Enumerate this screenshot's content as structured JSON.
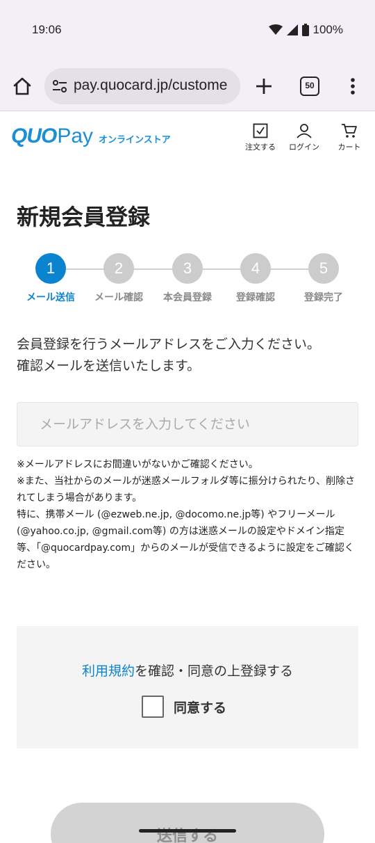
{
  "status_bar": {
    "time": "19:06",
    "battery": "100%"
  },
  "browser": {
    "url": "pay.quocard.jp/custome",
    "tab_count": "50"
  },
  "header": {
    "logo_main": "QUO",
    "logo_pay": "Pay",
    "logo_sub": "オンラインストア",
    "order_label": "注文する",
    "login_label": "ログイン",
    "cart_label": "カート"
  },
  "page": {
    "title": "新規会員登録"
  },
  "stepper": {
    "steps": [
      {
        "number": "1",
        "label": "メール送信",
        "active": true
      },
      {
        "number": "2",
        "label": "メール確認",
        "active": false
      },
      {
        "number": "3",
        "label": "本会員登録",
        "active": false
      },
      {
        "number": "4",
        "label": "登録確認",
        "active": false
      },
      {
        "number": "5",
        "label": "登録完了",
        "active": false
      }
    ]
  },
  "intro": {
    "line1": "会員登録を行うメールアドレスをご入力ください。",
    "line2": "確認メールを送信いたします。"
  },
  "email": {
    "placeholder": "メールアドレスを入力してください",
    "value": ""
  },
  "notes": {
    "note1": "※メールアドレスにお間違いがないかご確認ください。",
    "note2": "※また、当社からのメールが迷惑メールフォルダ等に振分けられたり、削除されてしまう場合があります。",
    "note3": "特に、携帯メール (@ezweb.ne.jp, @docomo.ne.jp等) やフリーメール (@yahoo.co.jp, @gmail.com等) の方は迷惑メールの設定やドメイン指定等、「@quocardpay.com」からのメールが受信できるように設定をご確認ください。"
  },
  "agreement": {
    "terms_link": "利用規約",
    "terms_suffix": "を確認・同意の上登録する",
    "checkbox_label": "同意する",
    "checked": false
  },
  "submit": {
    "label": "送信する"
  },
  "colors": {
    "accent": "#0b84cf",
    "logo": "#1a8fd6",
    "inactive_step": "#cccccc",
    "disabled_button": "#d3d3d3"
  }
}
